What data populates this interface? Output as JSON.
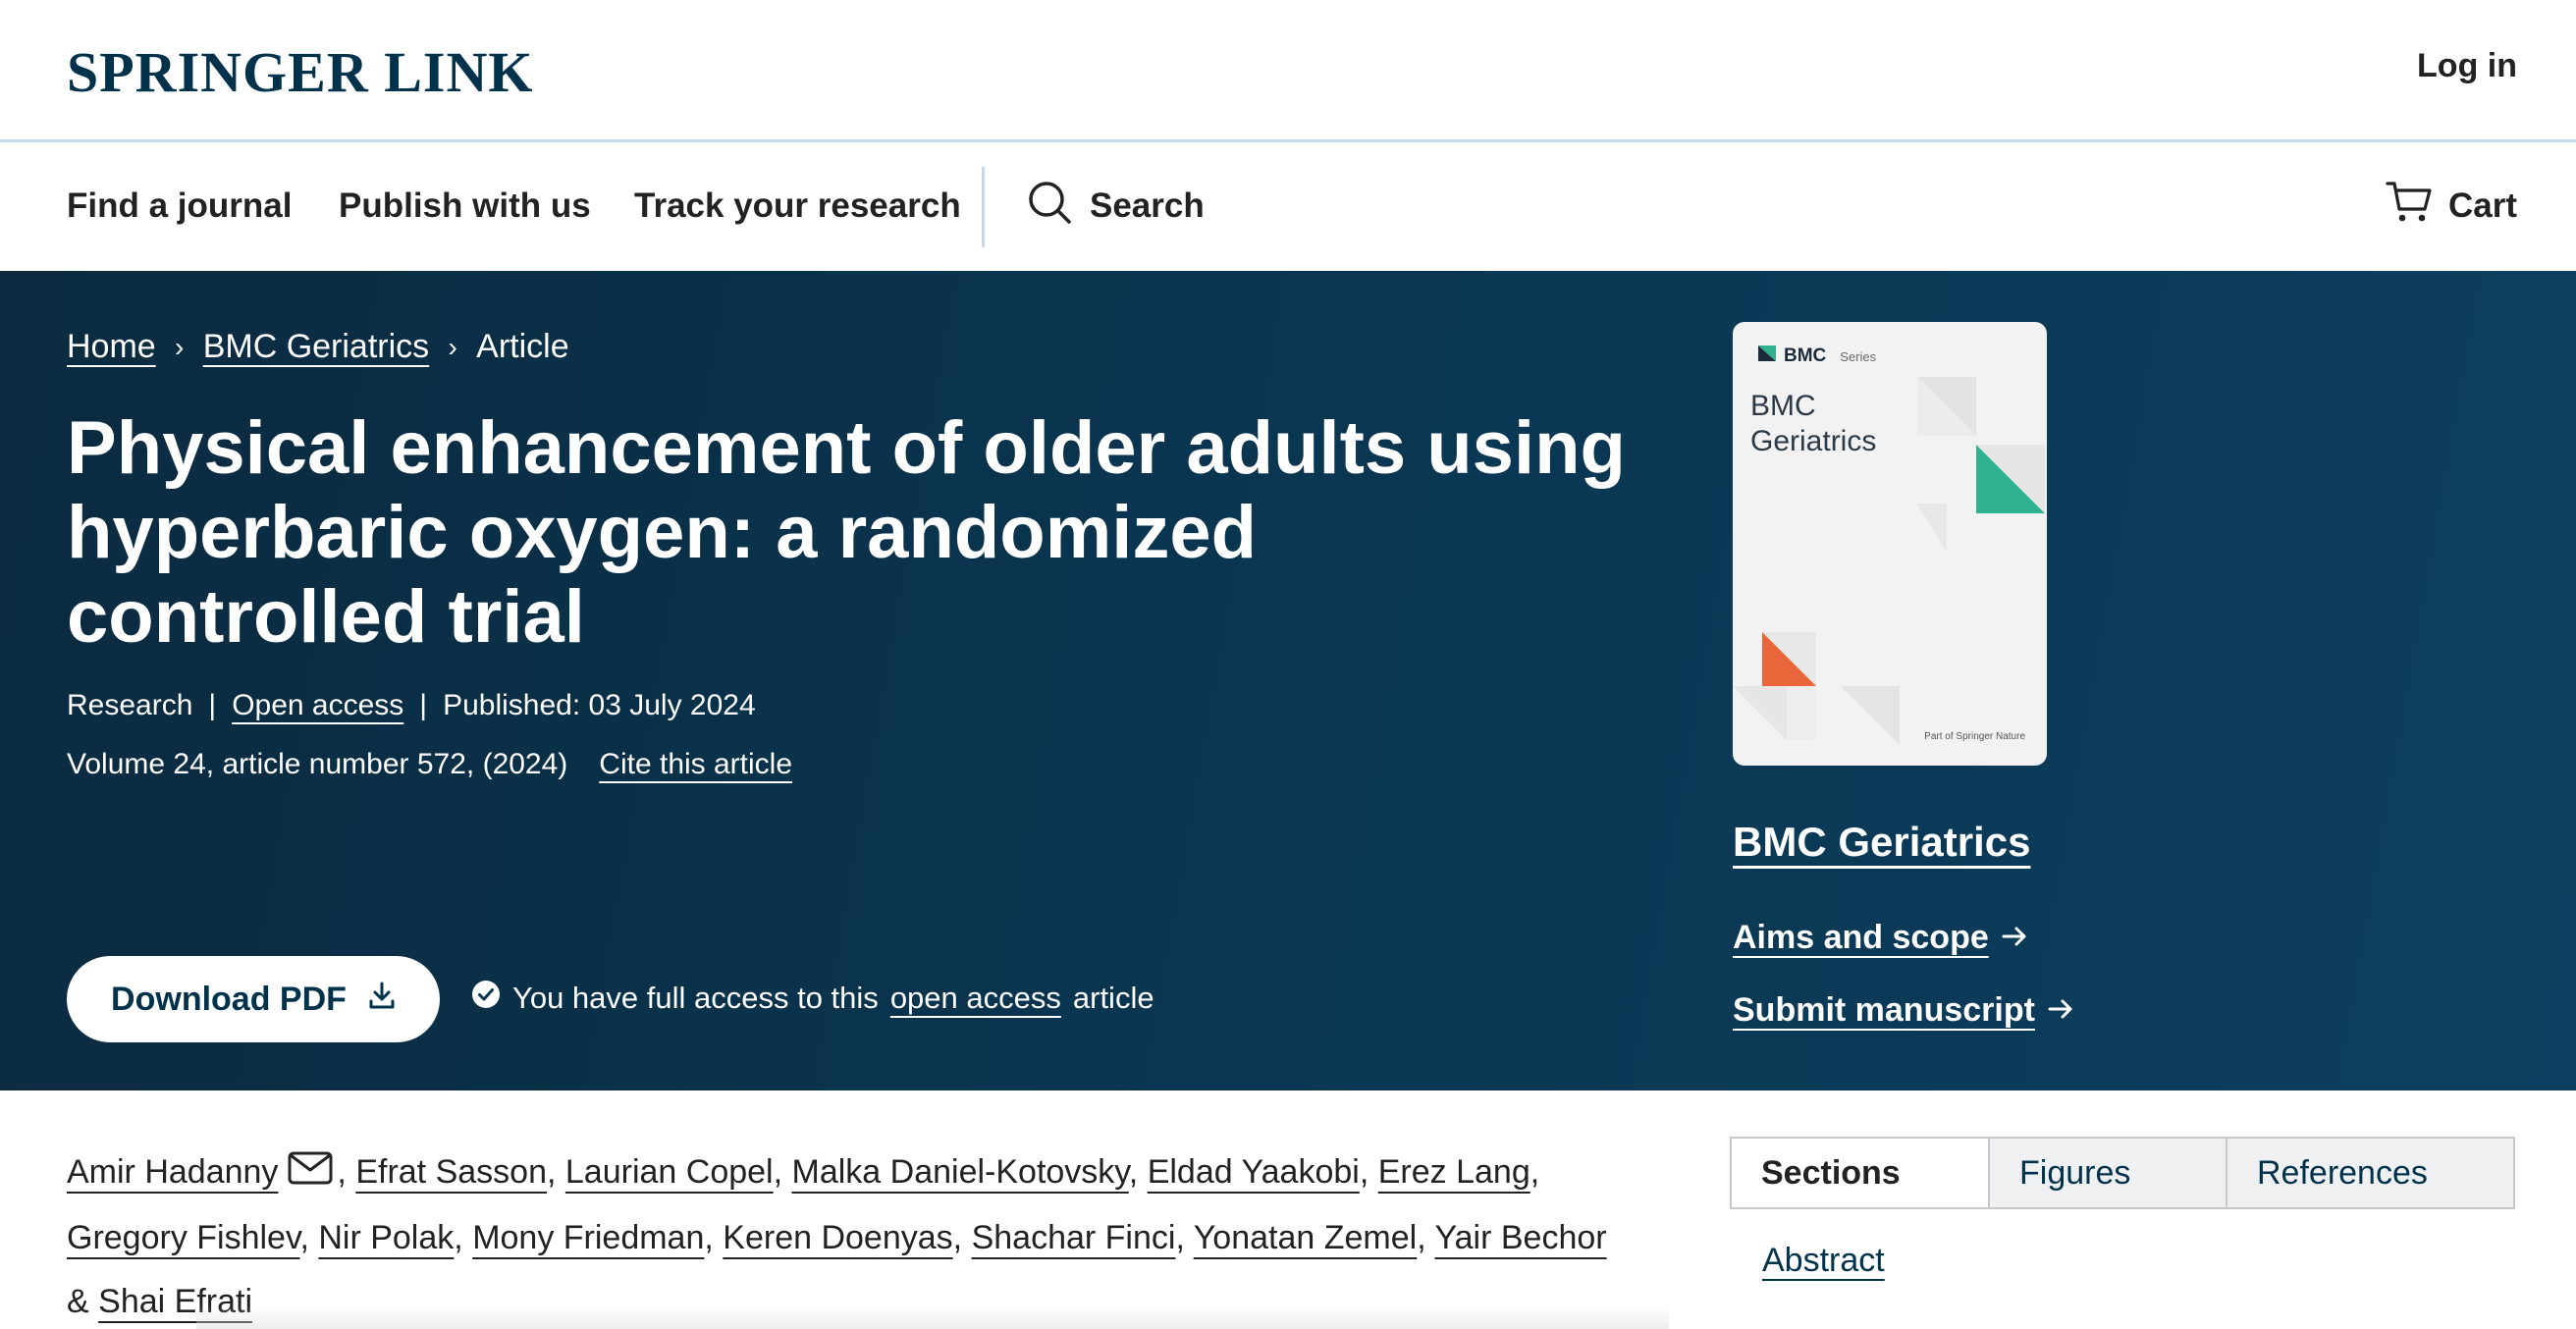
{
  "header": {
    "logo": "SPRINGER LINK",
    "login_label": "Log in"
  },
  "nav": {
    "items": [
      {
        "label": "Find a journal"
      },
      {
        "label": "Publish with us"
      },
      {
        "label": "Track your research"
      }
    ],
    "search_label": "Search",
    "cart_label": "Cart"
  },
  "breadcrumb": {
    "items": [
      "Home",
      "BMC Geriatrics"
    ],
    "current": "Article"
  },
  "article": {
    "title": "Physical enhancement of older adults using hyperbaric oxygen: a randomized controlled trial",
    "type": "Research",
    "access": "Open access",
    "published": "Published: 03 July 2024",
    "volume": "Volume 24, article number 572, (2024)",
    "cite_label": "Cite this article",
    "download_label": "Download PDF",
    "access_note_prefix": "You have full access to this",
    "access_note_link": "open access",
    "access_note_suffix": "article"
  },
  "journal": {
    "cover_brand": "BMC",
    "cover_series": "Series",
    "cover_title": "BMC Geriatrics",
    "cover_footer": "Part of Springer Nature",
    "name": "BMC Geriatrics",
    "aims_label": "Aims and scope",
    "submit_label": "Submit manuscript"
  },
  "authors": {
    "list": [
      "Amir Hadanny",
      "Efrat Sasson",
      "Laurian Copel",
      "Malka Daniel-Kotovsky",
      "Eldad Yaakobi",
      "Erez Lang",
      "Gregory Fishlev",
      "Nir Polak",
      "Mony Friedman",
      "Keren Doenyas",
      "Shachar Finci",
      "Yonatan Zemel",
      "Yair Bechor",
      "Shai Efrati"
    ],
    "and": "&"
  },
  "sections_tabs": [
    "Sections",
    "Figures",
    "References"
  ],
  "sections": {
    "first_link": "Abstract"
  },
  "colors": {
    "brand_navy": "#01324b",
    "hero_bg": "#0a3550",
    "cover_teal": "#2fb08f",
    "cover_orange": "#e8663a"
  }
}
